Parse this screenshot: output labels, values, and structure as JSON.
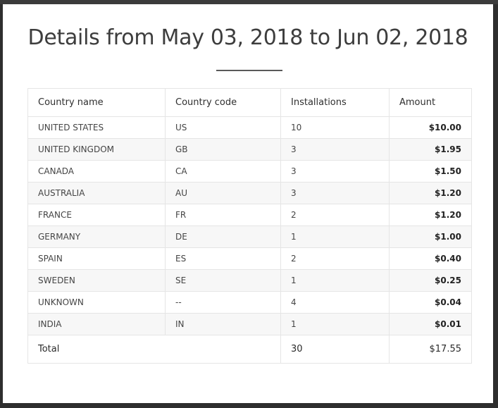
{
  "modal": {
    "title": "Details from May 03, 2018 to Jun 02, 2018"
  },
  "table": {
    "headers": {
      "country_name": "Country name",
      "country_code": "Country code",
      "installations": "Installations",
      "amount": "Amount"
    },
    "rows": [
      {
        "country_name": "UNITED STATES",
        "country_code": "US",
        "installations": "10",
        "amount": "$10.00"
      },
      {
        "country_name": "UNITED KINGDOM",
        "country_code": "GB",
        "installations": "3",
        "amount": "$1.95"
      },
      {
        "country_name": "CANADA",
        "country_code": "CA",
        "installations": "3",
        "amount": "$1.50"
      },
      {
        "country_name": "AUSTRALIA",
        "country_code": "AU",
        "installations": "3",
        "amount": "$1.20"
      },
      {
        "country_name": "FRANCE",
        "country_code": "FR",
        "installations": "2",
        "amount": "$1.20"
      },
      {
        "country_name": "GERMANY",
        "country_code": "DE",
        "installations": "1",
        "amount": "$1.00"
      },
      {
        "country_name": "SPAIN",
        "country_code": "ES",
        "installations": "2",
        "amount": "$0.40"
      },
      {
        "country_name": "SWEDEN",
        "country_code": "SE",
        "installations": "1",
        "amount": "$0.25"
      },
      {
        "country_name": "UNKNOWN",
        "country_code": "--",
        "installations": "4",
        "amount": "$0.04"
      },
      {
        "country_name": "INDIA",
        "country_code": "IN",
        "installations": "1",
        "amount": "$0.01"
      }
    ],
    "footer": {
      "label": "Total",
      "installations": "30",
      "amount": "$17.55"
    }
  }
}
